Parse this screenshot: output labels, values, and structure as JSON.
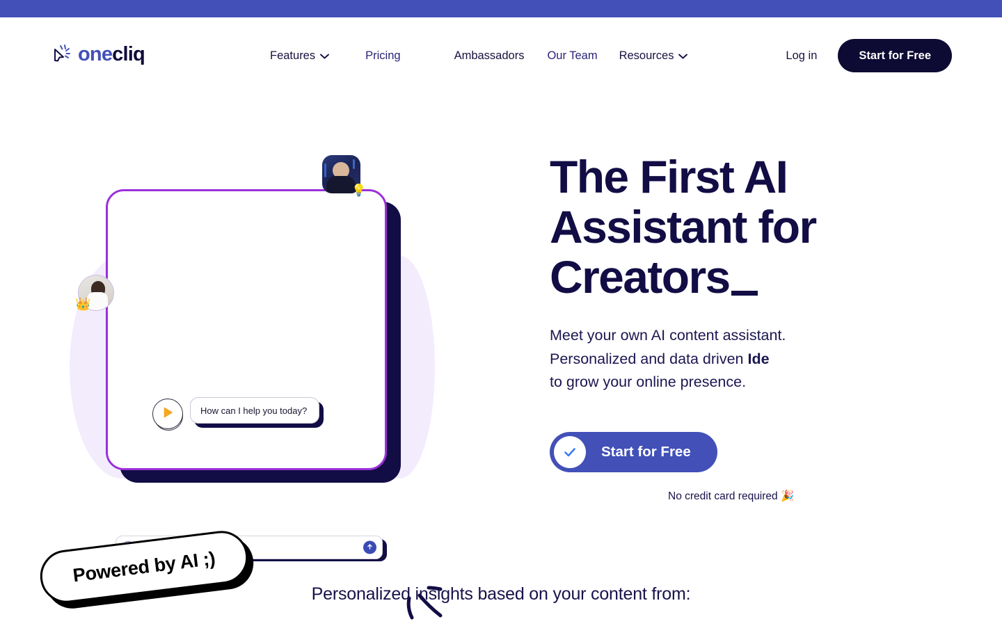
{
  "theme": {
    "accent_blue": "#4250b8",
    "dark_navy": "#120d44",
    "button_dark": "#0d0a33",
    "purple_border": "#9b30d9",
    "blob_purple": "#f3ecfd",
    "play_orange": "#f5a623"
  },
  "topbar": {
    "label": ""
  },
  "header": {
    "logo": {
      "icon": "cursor-click-icon",
      "text_one": "one",
      "text_cliq": "cliq"
    },
    "nav": [
      {
        "label": "Features",
        "has_chevron": true,
        "accent": false
      },
      {
        "label": "Pricing",
        "has_chevron": false,
        "accent": true
      },
      {
        "label": "Ambassadors",
        "has_chevron": false,
        "accent": false
      },
      {
        "label": "Our Team",
        "has_chevron": false,
        "accent": true
      },
      {
        "label": "Resources",
        "has_chevron": true,
        "accent": false
      }
    ],
    "login_label": "Log in",
    "cta_label": "Start for Free"
  },
  "hero": {
    "headline_line1": "The First AI",
    "headline_line2": "Assistant for",
    "headline_line3": "Creators",
    "subhead_line1": "Meet your own AI content assistant.",
    "subhead_line2_a": "Personalized and data driven ",
    "subhead_line2_b": "Ide",
    "subhead_line3": "to grow your online presence.",
    "cta_label": "Start for Free",
    "cta_icon": "check-icon",
    "no_card_note": "No credit card required 🎉"
  },
  "mock": {
    "bubble_text": "How can I help you today?",
    "input_placeholder": "",
    "input_value": "",
    "plus_icon": "plus-circle-icon",
    "send_icon": "arrow-up-icon",
    "play_icon": "play-icon",
    "badge_text": "Powered by AI ;)",
    "avatar_top_emoji": "💡",
    "avatar_left_emoji": "👑"
  },
  "bottom": {
    "title": "Personalized insights based on your content from:"
  }
}
